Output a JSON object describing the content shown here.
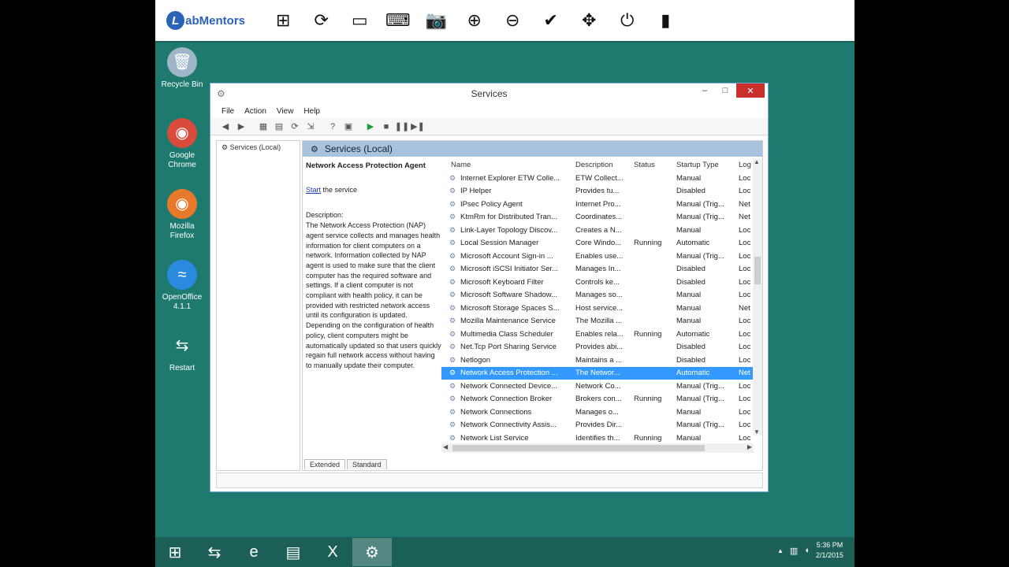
{
  "topbar": {
    "brand": "abMentors",
    "brand_mark": "L",
    "tools": [
      {
        "icon": "windows-icon",
        "glyph": "⊞"
      },
      {
        "icon": "refresh-icon",
        "glyph": "⟳"
      },
      {
        "icon": "monitor-icon",
        "glyph": "▭"
      },
      {
        "icon": "keyboard-icon",
        "glyph": "⌨"
      },
      {
        "icon": "camera-icon",
        "glyph": "📷"
      },
      {
        "icon": "zoom-in-icon",
        "glyph": "⊕"
      },
      {
        "icon": "zoom-out-icon",
        "glyph": "⊖"
      },
      {
        "icon": "check-icon",
        "glyph": "✔"
      },
      {
        "icon": "move-icon",
        "glyph": "✥"
      },
      {
        "icon": "power-icon",
        "glyph": "⏻"
      },
      {
        "icon": "book-icon",
        "glyph": "▮"
      }
    ]
  },
  "desktop": {
    "icons": [
      {
        "label": "Recycle Bin",
        "icon": "recycle-bin-icon",
        "color": "#9fb5c9",
        "glyph": "🗑"
      },
      {
        "label": "Google Chrome",
        "icon": "chrome-icon",
        "color": "#d94b3a",
        "glyph": "◉"
      },
      {
        "label": "Mozilla Firefox",
        "icon": "firefox-icon",
        "color": "#e8792a",
        "glyph": "◉"
      },
      {
        "label": "OpenOffice 4.1.1",
        "icon": "openoffice-icon",
        "color": "#2a8ae0",
        "glyph": "≈"
      },
      {
        "label": "Restart",
        "icon": "restart-icon",
        "color": "#1e7a6e",
        "glyph": "⇆"
      }
    ]
  },
  "window": {
    "title": "Services",
    "menu": [
      "File",
      "Action",
      "View",
      "Help"
    ],
    "tree_root": "Services (Local)",
    "header": "Services (Local)",
    "detail": {
      "name": "Network Access Protection Agent",
      "start_link": "Start",
      "start_rest": " the service",
      "desc_label": "Description:",
      "desc_text": "The Network Access Protection (NAP) agent service collects and manages health information for client computers on a network. Information collected by NAP agent is used to make sure that the client computer has the required software and settings. If a client computer is not compliant with health policy, it can be provided with restricted network access until its configuration is updated. Depending on the configuration of health policy, client computers might be automatically updated so that users quickly regain full network access without having to manually update their computer."
    },
    "columns": {
      "name": "Name",
      "description": "Description",
      "status": "Status",
      "startup": "Startup Type",
      "log": "Log"
    },
    "rows": [
      {
        "name": "Internet Explorer ETW Colle...",
        "desc": "ETW Collect...",
        "status": "",
        "startup": "Manual",
        "log": "Loc"
      },
      {
        "name": "IP Helper",
        "desc": "Provides tu...",
        "status": "",
        "startup": "Disabled",
        "log": "Loc"
      },
      {
        "name": "IPsec Policy Agent",
        "desc": "Internet Pro...",
        "status": "",
        "startup": "Manual (Trig...",
        "log": "Net"
      },
      {
        "name": "KtmRm for Distributed Tran...",
        "desc": "Coordinates...",
        "status": "",
        "startup": "Manual (Trig...",
        "log": "Net"
      },
      {
        "name": "Link-Layer Topology Discov...",
        "desc": "Creates a N...",
        "status": "",
        "startup": "Manual",
        "log": "Loc"
      },
      {
        "name": "Local Session Manager",
        "desc": "Core Windo...",
        "status": "Running",
        "startup": "Automatic",
        "log": "Loc"
      },
      {
        "name": "Microsoft Account Sign-in ...",
        "desc": "Enables use...",
        "status": "",
        "startup": "Manual (Trig...",
        "log": "Loc"
      },
      {
        "name": "Microsoft iSCSI Initiator Ser...",
        "desc": "Manages In...",
        "status": "",
        "startup": "Disabled",
        "log": "Loc"
      },
      {
        "name": "Microsoft Keyboard Filter",
        "desc": "Controls ke...",
        "status": "",
        "startup": "Disabled",
        "log": "Loc"
      },
      {
        "name": "Microsoft Software Shadow...",
        "desc": "Manages so...",
        "status": "",
        "startup": "Manual",
        "log": "Loc"
      },
      {
        "name": "Microsoft Storage Spaces S...",
        "desc": "Host service...",
        "status": "",
        "startup": "Manual",
        "log": "Net"
      },
      {
        "name": "Mozilla Maintenance Service",
        "desc": "The Mozilla ...",
        "status": "",
        "startup": "Manual",
        "log": "Loc"
      },
      {
        "name": "Multimedia Class Scheduler",
        "desc": "Enables rela...",
        "status": "Running",
        "startup": "Automatic",
        "log": "Loc"
      },
      {
        "name": "Net.Tcp Port Sharing Service",
        "desc": "Provides abi...",
        "status": "",
        "startup": "Disabled",
        "log": "Loc"
      },
      {
        "name": "Netlogon",
        "desc": "Maintains a ...",
        "status": "",
        "startup": "Disabled",
        "log": "Loc"
      },
      {
        "name": "Network Access Protection ...",
        "desc": "The Networ...",
        "status": "",
        "startup": "Automatic",
        "log": "Net",
        "selected": true
      },
      {
        "name": "Network Connected Device...",
        "desc": "Network Co...",
        "status": "",
        "startup": "Manual (Trig...",
        "log": "Loc"
      },
      {
        "name": "Network Connection Broker",
        "desc": "Brokers con...",
        "status": "Running",
        "startup": "Manual (Trig...",
        "log": "Loc"
      },
      {
        "name": "Network Connections",
        "desc": "Manages o...",
        "status": "",
        "startup": "Manual",
        "log": "Loc"
      },
      {
        "name": "Network Connectivity Assis...",
        "desc": "Provides Dir...",
        "status": "",
        "startup": "Manual (Trig...",
        "log": "Loc"
      },
      {
        "name": "Network List Service",
        "desc": "Identifies th...",
        "status": "Running",
        "startup": "Manual",
        "log": "Loc"
      }
    ],
    "tabs": [
      "Extended",
      "Standard"
    ]
  },
  "taskbar": {
    "items": [
      {
        "icon": "start-icon",
        "glyph": "⊞"
      },
      {
        "icon": "restart-arrows-icon",
        "glyph": "⇆"
      },
      {
        "icon": "internet-explorer-icon",
        "glyph": "e"
      },
      {
        "icon": "file-explorer-icon",
        "glyph": "▤"
      },
      {
        "icon": "excel-icon",
        "glyph": "X"
      },
      {
        "icon": "services-icon",
        "glyph": "⚙",
        "active": true
      }
    ],
    "time": "5:36 PM",
    "date": "2/1/2015"
  }
}
